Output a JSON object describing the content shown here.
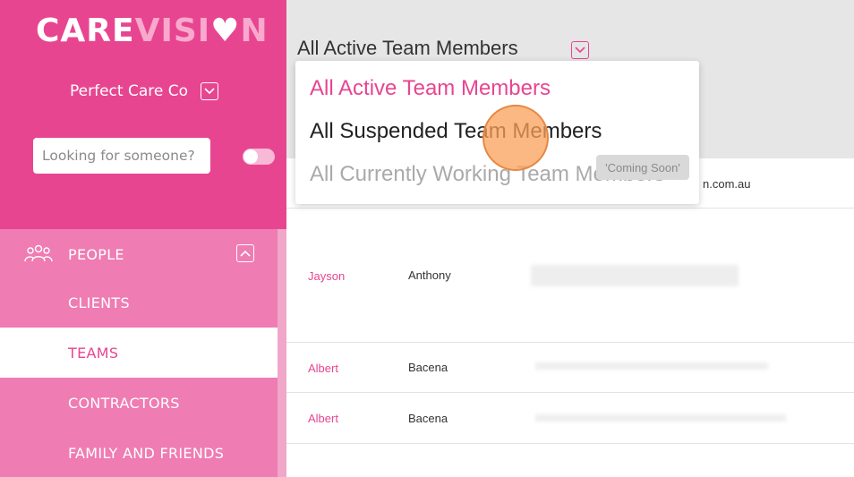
{
  "sidebar": {
    "logo": {
      "care": "CARE",
      "visi": "VISI",
      "heart": "♥",
      "n": "N"
    },
    "org_name": "Perfect Care Co",
    "search_placeholder": "Looking for someone?",
    "nav": {
      "section_label": "PEOPLE",
      "items": [
        {
          "label": "CLIENTS"
        },
        {
          "label": "TEAMS"
        },
        {
          "label": "CONTRACTORS"
        },
        {
          "label": "FAMILY AND FRIENDS"
        }
      ]
    }
  },
  "main": {
    "title": "All Active Team Members",
    "dropdown": {
      "options": [
        {
          "label": "All Active Team Members"
        },
        {
          "label": "All Suspended Team Members"
        },
        {
          "label": "All Currently Working Team Members"
        }
      ],
      "tooltip": "'Coming Soon'"
    },
    "rows": [
      {
        "email_tail": "n.com.au"
      },
      {
        "first": "Jayson",
        "last": "Anthony"
      },
      {
        "first": "Albert",
        "last": "Bacena"
      },
      {
        "first": "Albert",
        "last": "Bacena"
      }
    ]
  },
  "colors": {
    "brand_pink": "#e84591",
    "nav_pink": "#ef7cb3",
    "header_gray": "#e6e6e6"
  }
}
